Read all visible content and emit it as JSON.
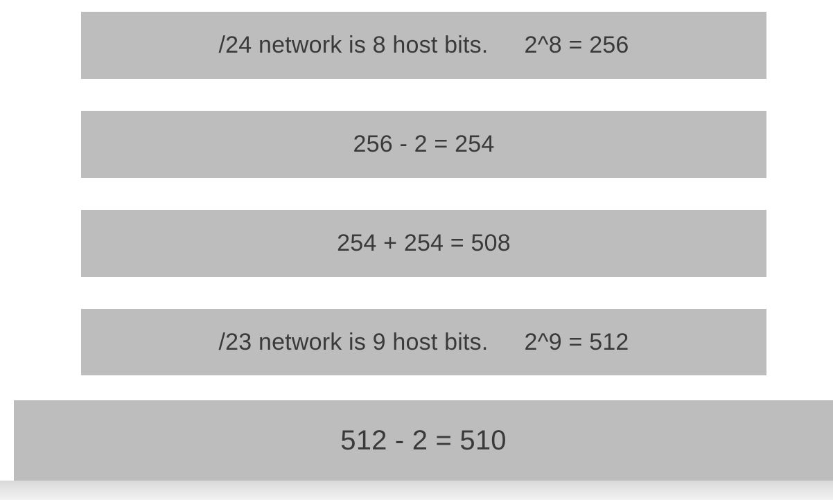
{
  "bands": [
    {
      "left": "/24 network is 8 host bits.",
      "right": "2^8 = 256"
    },
    {
      "text": "256 - 2 = 254"
    },
    {
      "text": "254 + 254 = 508"
    },
    {
      "left": "/23 network is 9 host bits.",
      "right": "2^9 = 512"
    },
    {
      "text": "512 - 2 = 510"
    }
  ],
  "colors": {
    "band_background": "#bdbdbd",
    "text": "#3a3a3a",
    "page_background": "#ffffff"
  }
}
